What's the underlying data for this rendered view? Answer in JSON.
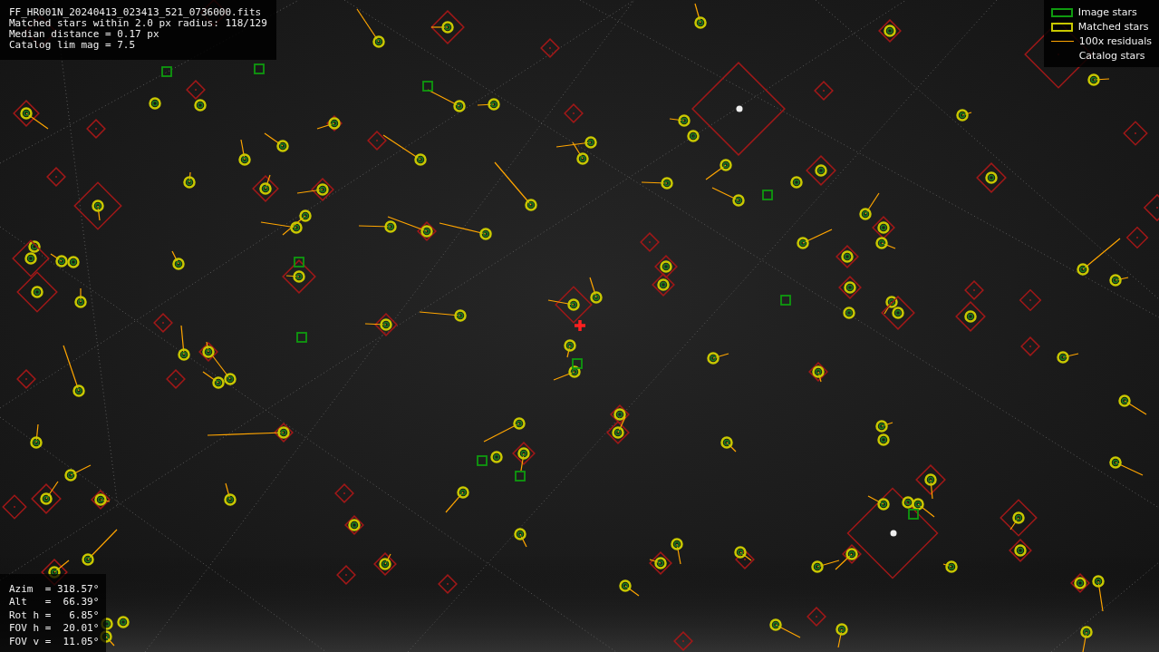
{
  "info_lines": [
    "FF_HR001N_20240413_023413_521_0736000.fits",
    "Matched stars within 2.0 px radius: 118/129",
    "Median distance = 0.17 px",
    "Catalog lim mag = 7.5"
  ],
  "legend": [
    {
      "kind": "box",
      "label": "Image stars",
      "color": "#0f9a0f"
    },
    {
      "kind": "box",
      "label": "Matched stars",
      "color": "#c8c800"
    },
    {
      "kind": "line",
      "label": "100x residuals",
      "color": "#ffa500"
    },
    {
      "kind": "none",
      "label": "Catalog stars"
    }
  ],
  "pointing_lines": [
    "Azim  = 318.57°",
    "Alt   =  66.39°",
    "Rot h =   6.85°",
    "FOV h =  20.01°",
    "FOV v =  11.05°"
  ]
}
